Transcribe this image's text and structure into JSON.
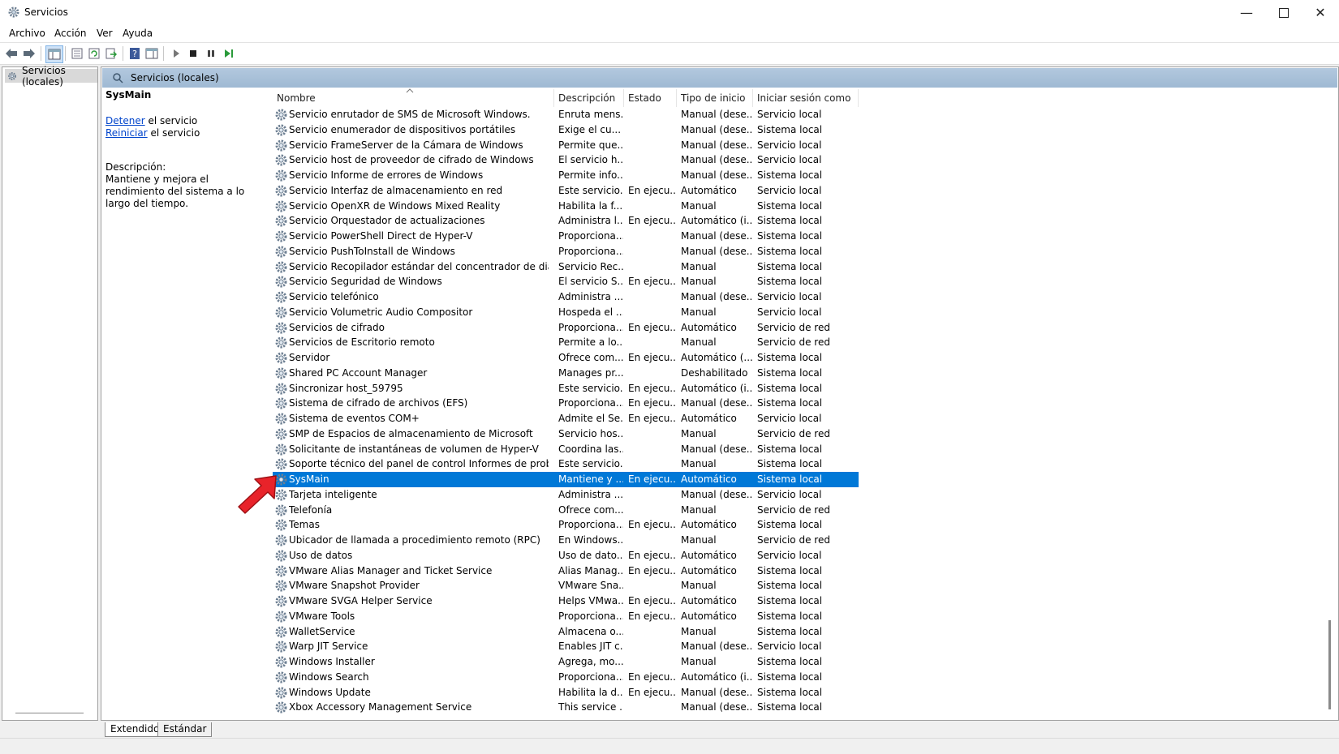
{
  "window": {
    "title": "Servicios"
  },
  "menu": [
    "Archivo",
    "Acción",
    "Ver",
    "Ayuda"
  ],
  "tree": {
    "root_label": "Servicios (locales)"
  },
  "panel": {
    "header": "Servicios (locales)"
  },
  "details": {
    "service_name": "SysMain",
    "stop_link": "Detener",
    "stop_suffix": " el servicio",
    "restart_link": "Reiniciar",
    "restart_suffix": " el servicio",
    "description_label": "Descripción:",
    "description_text": "Mantiene y mejora el rendimiento del sistema a lo largo del tiempo."
  },
  "columns": [
    "Nombre",
    "Descripción",
    "Estado",
    "Tipo de inicio",
    "Iniciar sesión como"
  ],
  "rows": [
    [
      "Servicio enrutador de SMS de Microsoft Windows.",
      "Enruta mens...",
      "",
      "Manual (dese...",
      "Servicio local"
    ],
    [
      "Servicio enumerador de dispositivos portátiles",
      "Exige el cu...",
      "",
      "Manual (dese...",
      "Sistema local"
    ],
    [
      "Servicio FrameServer de la Cámara de Windows",
      "Permite que...",
      "",
      "Manual (dese...",
      "Servicio local"
    ],
    [
      "Servicio host de proveedor de cifrado de Windows",
      "El servicio h...",
      "",
      "Manual (dese...",
      "Servicio local"
    ],
    [
      "Servicio Informe de errores de Windows",
      "Permite info...",
      "",
      "Manual (dese...",
      "Sistema local"
    ],
    [
      "Servicio Interfaz de almacenamiento en red",
      "Este servicio...",
      "En ejecu...",
      "Automático",
      "Servicio local"
    ],
    [
      "Servicio OpenXR de Windows Mixed Reality",
      "Habilita la f...",
      "",
      "Manual",
      "Sistema local"
    ],
    [
      "Servicio Orquestador de actualizaciones",
      "Administra l...",
      "En ejecu...",
      "Automático (i...",
      "Sistema local"
    ],
    [
      "Servicio PowerShell Direct de Hyper-V",
      "Proporciona...",
      "",
      "Manual (dese...",
      "Sistema local"
    ],
    [
      "Servicio PushToInstall de Windows",
      "Proporciona...",
      "",
      "Manual (dese...",
      "Sistema local"
    ],
    [
      "Servicio Recopilador estándar del concentrador de diagnósti...",
      "Servicio Rec...",
      "",
      "Manual",
      "Sistema local"
    ],
    [
      "Servicio Seguridad de Windows",
      "El servicio S...",
      "En ejecu...",
      "Manual",
      "Sistema local"
    ],
    [
      "Servicio telefónico",
      "Administra ...",
      "",
      "Manual (dese...",
      "Servicio local"
    ],
    [
      "Servicio Volumetric Audio Compositor",
      "Hospeda el ...",
      "",
      "Manual",
      "Servicio local"
    ],
    [
      "Servicios de cifrado",
      "Proporciona...",
      "En ejecu...",
      "Automático",
      "Servicio de red"
    ],
    [
      "Servicios de Escritorio remoto",
      "Permite a lo...",
      "",
      "Manual",
      "Servicio de red"
    ],
    [
      "Servidor",
      "Ofrece com...",
      "En ejecu...",
      "Automático (...",
      "Sistema local"
    ],
    [
      "Shared PC Account Manager",
      "Manages pr...",
      "",
      "Deshabilitado",
      "Sistema local"
    ],
    [
      "Sincronizar host_59795",
      "Este servicio...",
      "En ejecu...",
      "Automático (i...",
      "Sistema local"
    ],
    [
      "Sistema de cifrado de archivos (EFS)",
      "Proporciona...",
      "En ejecu...",
      "Manual (dese...",
      "Sistema local"
    ],
    [
      "Sistema de eventos COM+",
      "Admite el Se...",
      "En ejecu...",
      "Automático",
      "Servicio local"
    ],
    [
      "SMP de Espacios de almacenamiento de Microsoft",
      "Servicio hos...",
      "",
      "Manual",
      "Servicio de red"
    ],
    [
      "Solicitante de instantáneas de volumen de Hyper-V",
      "Coordina las...",
      "",
      "Manual (dese...",
      "Sistema local"
    ],
    [
      "Soporte técnico del panel de control Informes de problemas",
      "Este servicio...",
      "",
      "Manual",
      "Sistema local"
    ],
    [
      "SysMain",
      "Mantiene y ...",
      "En ejecu...",
      "Automático",
      "Sistema local"
    ],
    [
      "Tarjeta inteligente",
      "Administra ...",
      "",
      "Manual (dese...",
      "Servicio local"
    ],
    [
      "Telefonía",
      "Ofrece com...",
      "",
      "Manual",
      "Servicio de red"
    ],
    [
      "Temas",
      "Proporciona...",
      "En ejecu...",
      "Automático",
      "Sistema local"
    ],
    [
      "Ubicador de llamada a procedimiento remoto (RPC)",
      "En Windows...",
      "",
      "Manual",
      "Servicio de red"
    ],
    [
      "Uso de datos",
      "Uso de dato...",
      "En ejecu...",
      "Automático",
      "Servicio local"
    ],
    [
      "VMware Alias Manager and Ticket Service",
      "Alias Manag...",
      "En ejecu...",
      "Automático",
      "Sistema local"
    ],
    [
      "VMware Snapshot Provider",
      "VMware Sna...",
      "",
      "Manual",
      "Sistema local"
    ],
    [
      "VMware SVGA Helper Service",
      "Helps VMwa...",
      "En ejecu...",
      "Automático",
      "Sistema local"
    ],
    [
      "VMware Tools",
      "Proporciona...",
      "En ejecu...",
      "Automático",
      "Sistema local"
    ],
    [
      "WalletService",
      "Almacena o...",
      "",
      "Manual",
      "Sistema local"
    ],
    [
      "Warp JIT Service",
      "Enables JIT c...",
      "",
      "Manual (dese...",
      "Servicio local"
    ],
    [
      "Windows Installer",
      "Agrega, mo...",
      "",
      "Manual",
      "Sistema local"
    ],
    [
      "Windows Search",
      "Proporciona...",
      "En ejecu...",
      "Automático (i...",
      "Sistema local"
    ],
    [
      "Windows Update",
      "Habilita la d...",
      "En ejecu...",
      "Manual (dese...",
      "Sistema local"
    ],
    [
      "Xbox Accessory Management Service",
      "This service ...",
      "",
      "Manual (dese...",
      "Sistema local"
    ]
  ],
  "selected_row": "SysMain",
  "tabs": [
    "Extendido",
    "Estándar"
  ],
  "colors": {
    "selection": "#0078d7",
    "header": "#a9c1da",
    "arrow": "#e8232a"
  }
}
